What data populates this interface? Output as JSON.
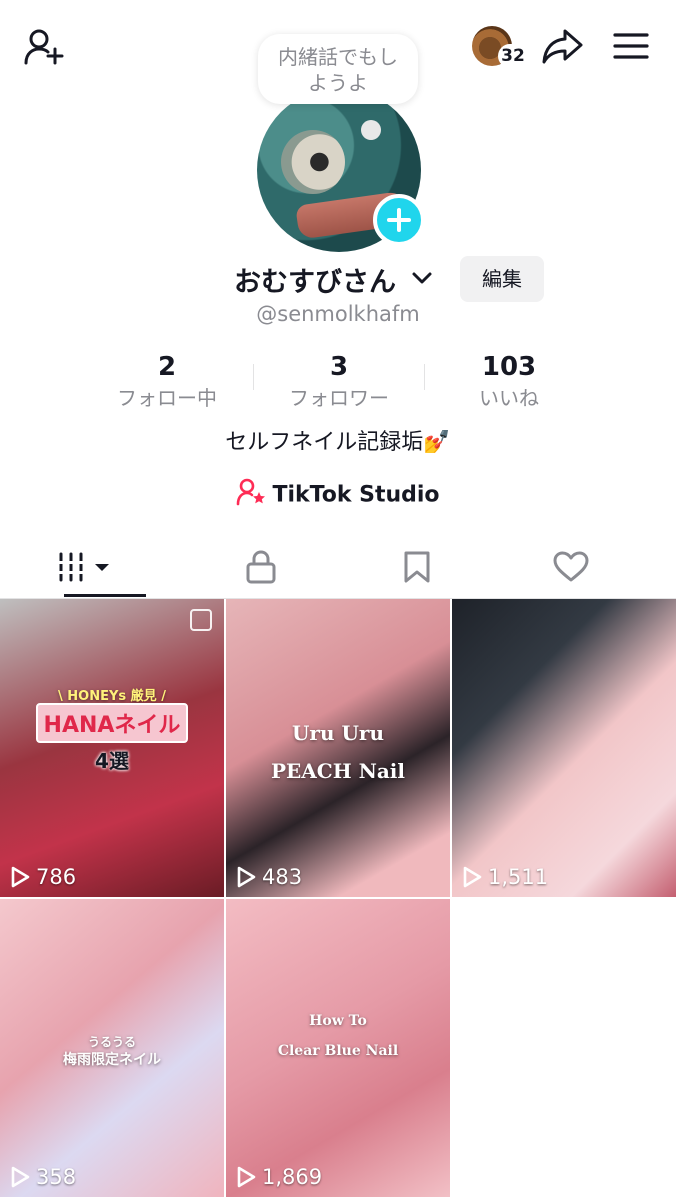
{
  "header": {
    "friend_count": "32",
    "bubble_text_line1": "内緒話でもし",
    "bubble_text_line2": "ようよ"
  },
  "profile": {
    "display_name": "おむすびさん",
    "edit_label": "編集",
    "handle": "@senmolkhafm",
    "bio": "セルフネイル記録垢💅",
    "studio_label": "TikTok Studio"
  },
  "stats": [
    {
      "value": "2",
      "label": "フォロー中"
    },
    {
      "value": "3",
      "label": "フォロワー"
    },
    {
      "value": "103",
      "label": "いいね"
    }
  ],
  "tabs": [
    "videos-grid-icon",
    "lock-icon",
    "bookmark-icon",
    "heart-icon"
  ],
  "videos": [
    {
      "views": "786",
      "overlay1": "\\ HONEYs 厳見 /",
      "overlay2": "HANAネイル",
      "overlay3": "4選"
    },
    {
      "views": "483",
      "overlay1": "Uru Uru",
      "overlay2": "PEACH Nail"
    },
    {
      "views": "1,511"
    },
    {
      "views": "358",
      "overlay1": "うるうる",
      "overlay2": "梅雨限定ネイル"
    },
    {
      "views": "1,869",
      "overlay1": "How To",
      "overlay2": "Clear Blue Nail"
    }
  ],
  "colors": {
    "accent_plus": "#20d5ec",
    "studio_icon": "#fe2c55",
    "text_primary": "#161823",
    "text_secondary": "#8a8b91"
  }
}
